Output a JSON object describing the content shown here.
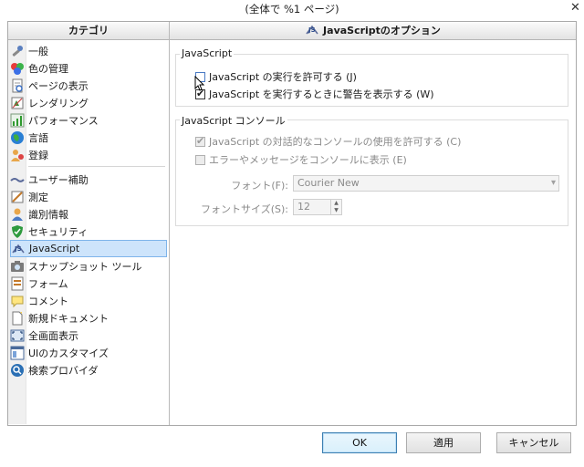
{
  "window": {
    "title": "(全体で %1 ページ)",
    "close_glyph": "✕"
  },
  "left_pane": {
    "header": "カテゴリ",
    "items": [
      {
        "label": "一般",
        "icon": "gear-wrench-icon"
      },
      {
        "label": "色の管理",
        "icon": "color-palette-icon"
      },
      {
        "label": "ページの表示",
        "icon": "page-view-icon"
      },
      {
        "label": "レンダリング",
        "icon": "rendering-icon"
      },
      {
        "label": "パフォーマンス",
        "icon": "performance-chart-icon"
      },
      {
        "label": "言語",
        "icon": "globe-icon"
      },
      {
        "label": "登録",
        "icon": "user-registration-icon"
      },
      {
        "label": "ユーザー補助",
        "icon": "accessibility-icon"
      },
      {
        "label": "測定",
        "icon": "measure-ruler-icon"
      },
      {
        "label": "識別情報",
        "icon": "identity-person-icon"
      },
      {
        "label": "セキュリティ",
        "icon": "security-shield-icon"
      },
      {
        "label": "JavaScript",
        "icon": "javascript-icon"
      },
      {
        "label": "スナップショット ツール",
        "icon": "snapshot-camera-icon"
      },
      {
        "label": "フォーム",
        "icon": "form-icon"
      },
      {
        "label": "コメント",
        "icon": "comment-bubble-icon"
      },
      {
        "label": "新規ドキュメント",
        "icon": "new-document-icon"
      },
      {
        "label": "全画面表示",
        "icon": "fullscreen-icon"
      },
      {
        "label": "UIのカスタマイズ",
        "icon": "ui-customize-icon"
      },
      {
        "label": "検索プロバイダ",
        "icon": "search-provider-icon"
      }
    ],
    "selected_index": 11
  },
  "right_pane": {
    "header": "JavaScriptのオプション",
    "group_javascript": {
      "label": "JavaScript",
      "allow_js": {
        "label": "JavaScript の実行を許可する (J)",
        "checked": false
      },
      "warn_on_run": {
        "label": "JavaScript を実行するときに警告を表示する (W)",
        "checked": true
      }
    },
    "group_console": {
      "label": "JavaScript コンソール",
      "allow_console": {
        "label": "JavaScript の対話的なコンソールの使用を許可する (C)",
        "checked": true,
        "disabled": true
      },
      "show_errors": {
        "label": "エラーやメッセージをコンソールに表示 (E)",
        "checked": false,
        "disabled": true
      },
      "font_label": "フォント(F):",
      "font_value": "Courier New",
      "fontsize_label": "フォントサイズ(S):",
      "fontsize_value": "12"
    }
  },
  "buttons": {
    "ok": "OK",
    "apply": "適用",
    "cancel": "キャンセル"
  },
  "colors": {
    "selection_bg": "#cde4fb",
    "selection_border": "#7eb4ea",
    "default_button_border": "#3c7fb1"
  }
}
